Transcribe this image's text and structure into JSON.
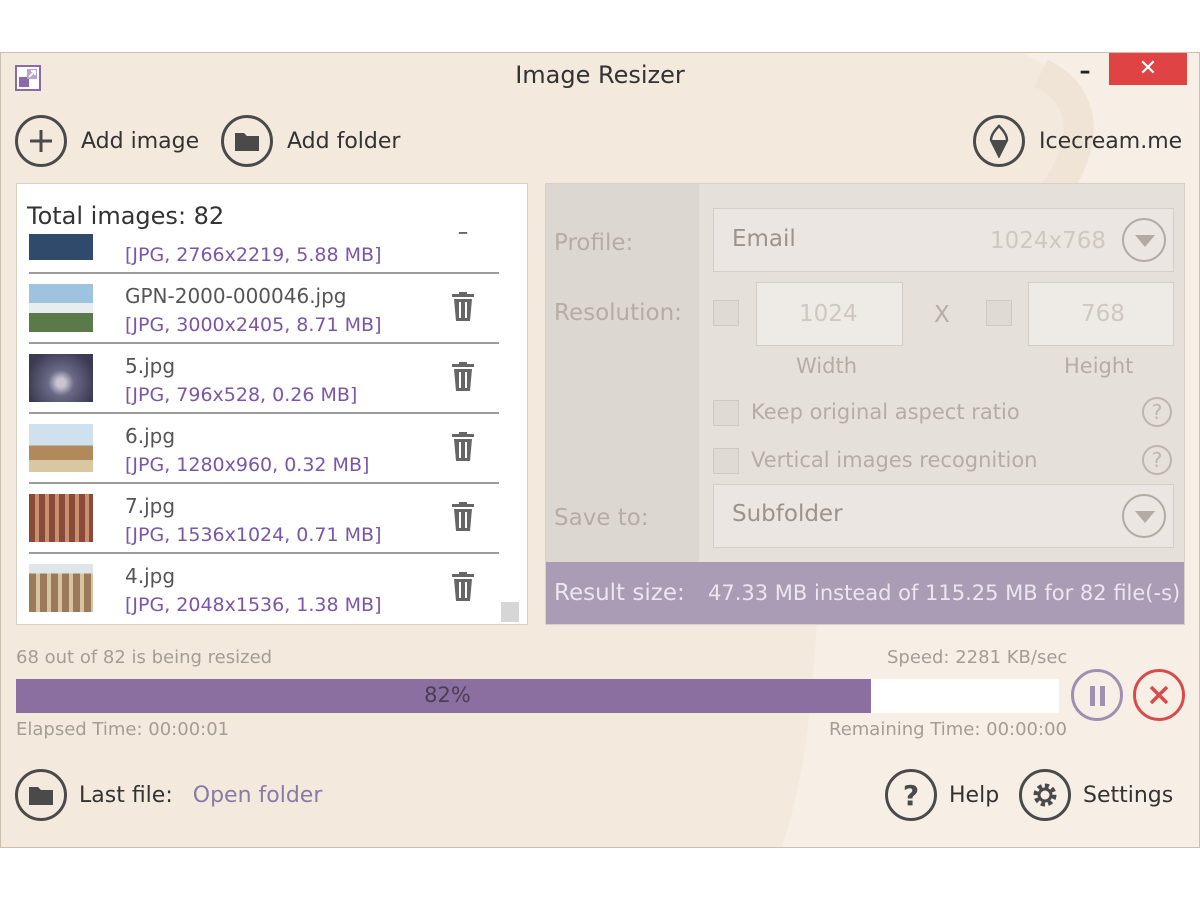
{
  "window": {
    "title": "Image Resizer",
    "minimize": "–",
    "close": "✕"
  },
  "toolbar": {
    "add_image": "Add image",
    "add_folder": "Add folder",
    "brand": "Icecream.me"
  },
  "list": {
    "total": "Total images: 82",
    "items": [
      {
        "name": "",
        "info": "[JPG, 2766x2219, 5.88 MB]",
        "thumb_color": "#2f4a6a"
      },
      {
        "name": "GPN-2000-000046.jpg",
        "info": "[JPG, 3000x2405, 8.71 MB]",
        "thumb_color": "#6d8f9e"
      },
      {
        "name": "5.jpg",
        "info": "[JPG, 796x528, 0.26 MB]",
        "thumb_color": "#5a5a78"
      },
      {
        "name": "6.jpg",
        "info": "[JPG, 1280x960, 0.32 MB]",
        "thumb_color": "#b08a5a"
      },
      {
        "name": "7.jpg",
        "info": "[JPG, 1536x1024, 0.71 MB]",
        "thumb_color": "#8a4a3a"
      },
      {
        "name": "4.jpg",
        "info": "[JPG, 2048x1536, 1.38 MB]",
        "thumb_color": "#9a7a5a"
      }
    ]
  },
  "settings": {
    "profile_label": "Profile:",
    "profile_value": "Email",
    "profile_size": "1024x768",
    "resolution_label": "Resolution:",
    "width_value": "1024",
    "height_value": "768",
    "x_sep": "X",
    "width_label": "Width",
    "height_label": "Height",
    "keep_aspect": "Keep original aspect ratio",
    "vertical_recog": "Vertical images recognition",
    "help_glyph": "?",
    "save_to_label": "Save to:",
    "save_to_value": "Subfolder",
    "result_label": "Result size:",
    "result_text": "47.33 MB instead of 115.25 MB for 82 file(-s)"
  },
  "progress": {
    "status": "68 out of 82 is being resized",
    "speed": "Speed: 2281 KB/sec",
    "percent_label": "82%",
    "percent": 82,
    "elapsed": "Elapsed Time: 00:00:01",
    "remaining": "Remaining Time: 00:00:00"
  },
  "bottom": {
    "last_file": "Last file:",
    "open_folder": "Open folder",
    "help": "Help",
    "settings": "Settings"
  },
  "colors": {
    "accent": "#8a6fa0",
    "link": "#7a56a8",
    "close": "#e04343",
    "background": "#f3e9dc"
  }
}
